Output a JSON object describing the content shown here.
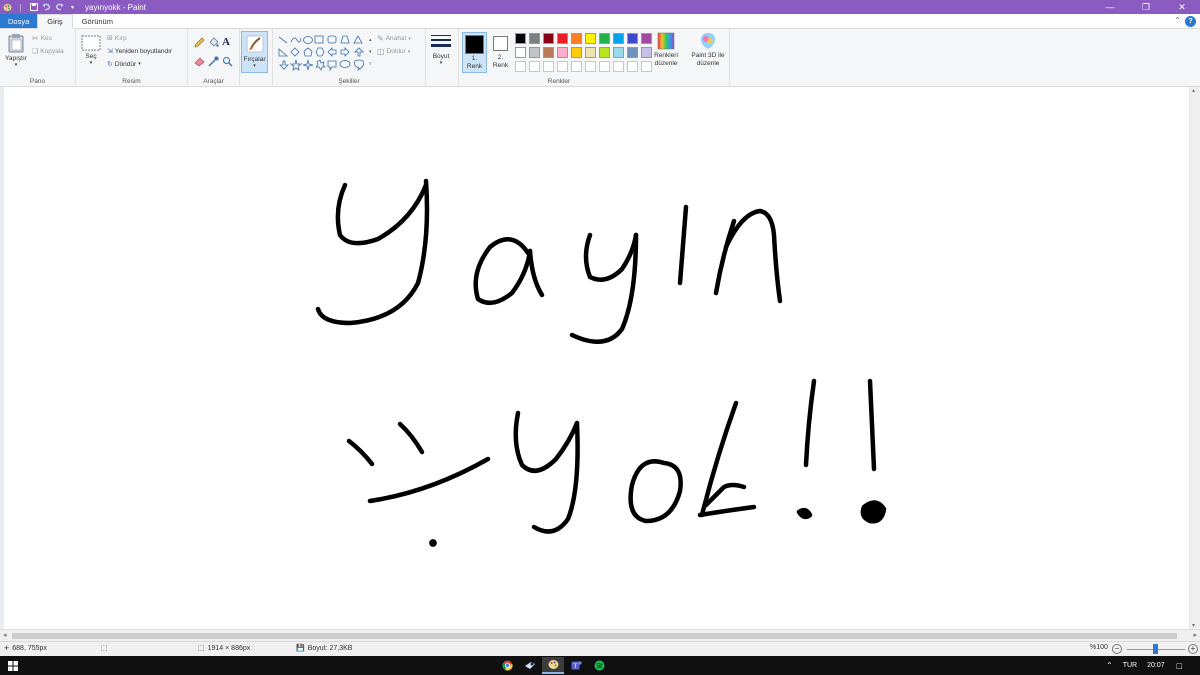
{
  "window": {
    "title": "yayınyokk - Paint",
    "controls": [
      "minimize-icon",
      "restore-icon",
      "close-icon"
    ]
  },
  "tabs": [
    {
      "label": "Dosya",
      "active": false
    },
    {
      "label": "Giriş",
      "active": true
    },
    {
      "label": "Görünüm",
      "active": false
    }
  ],
  "ribbon": {
    "clipboard": {
      "group_label": "Pano",
      "paste": "Yapıştır",
      "cut": "Kes",
      "copy": "Kopyala"
    },
    "image": {
      "group_label": "Resim",
      "select": "Seç",
      "crop": "Kırp",
      "resize": "Yeniden boyutlandır",
      "rotate": "Döndür"
    },
    "tools": {
      "group_label": "Araçlar",
      "items": [
        "pencil-icon",
        "fill-icon",
        "text-icon",
        "eraser-icon",
        "color-picker-icon",
        "magnifier-icon"
      ]
    },
    "brushes": {
      "label": "Fırçalar"
    },
    "shapes": {
      "group_label": "Şekiller",
      "outline": "Anahat",
      "fill": "Doldur"
    },
    "size": {
      "label": "Boyut"
    },
    "colors": {
      "group_label": "Renkler",
      "color1": "1.\nRenk",
      "color1_value": "#000000",
      "color2": "2.\nRenk",
      "color2_value": "#ffffff",
      "edit_colors": "Renkleri\ndüzenle",
      "paint3d": "Paint 3D ile\ndüzenle",
      "palette_row1": [
        "#000000",
        "#7f7f7f",
        "#880015",
        "#ed1c24",
        "#ff7f27",
        "#fff200",
        "#22b14c",
        "#00a2e8",
        "#3f48cc",
        "#a349a4"
      ],
      "palette_row2": [
        "#ffffff",
        "#c3c3c3",
        "#b97a57",
        "#ffaec9",
        "#ffc90e",
        "#efe4b0",
        "#b5e61d",
        "#99d9ea",
        "#7092be",
        "#c8bfe7"
      ],
      "palette_row3": [
        "#ffffff",
        "#ffffff",
        "#ffffff",
        "#ffffff",
        "#ffffff",
        "#ffffff",
        "#ffffff",
        "#ffffff",
        "#ffffff",
        "#ffffff"
      ]
    }
  },
  "canvas": {
    "handwritten_lines": [
      "Yayın",
      "Yok!!"
    ]
  },
  "status": {
    "cursor": "688, 755px",
    "image_size": "1914 × 886px",
    "file_size": "Boyut: 27,3KB",
    "zoom": "%100",
    "zoom_level": 1.0
  },
  "taskbar": {
    "apps": [
      "chrome-icon",
      "steam-icon",
      "paint-icon",
      "teams-icon",
      "spotify-icon"
    ],
    "language": "TUR",
    "time": "20:07"
  }
}
